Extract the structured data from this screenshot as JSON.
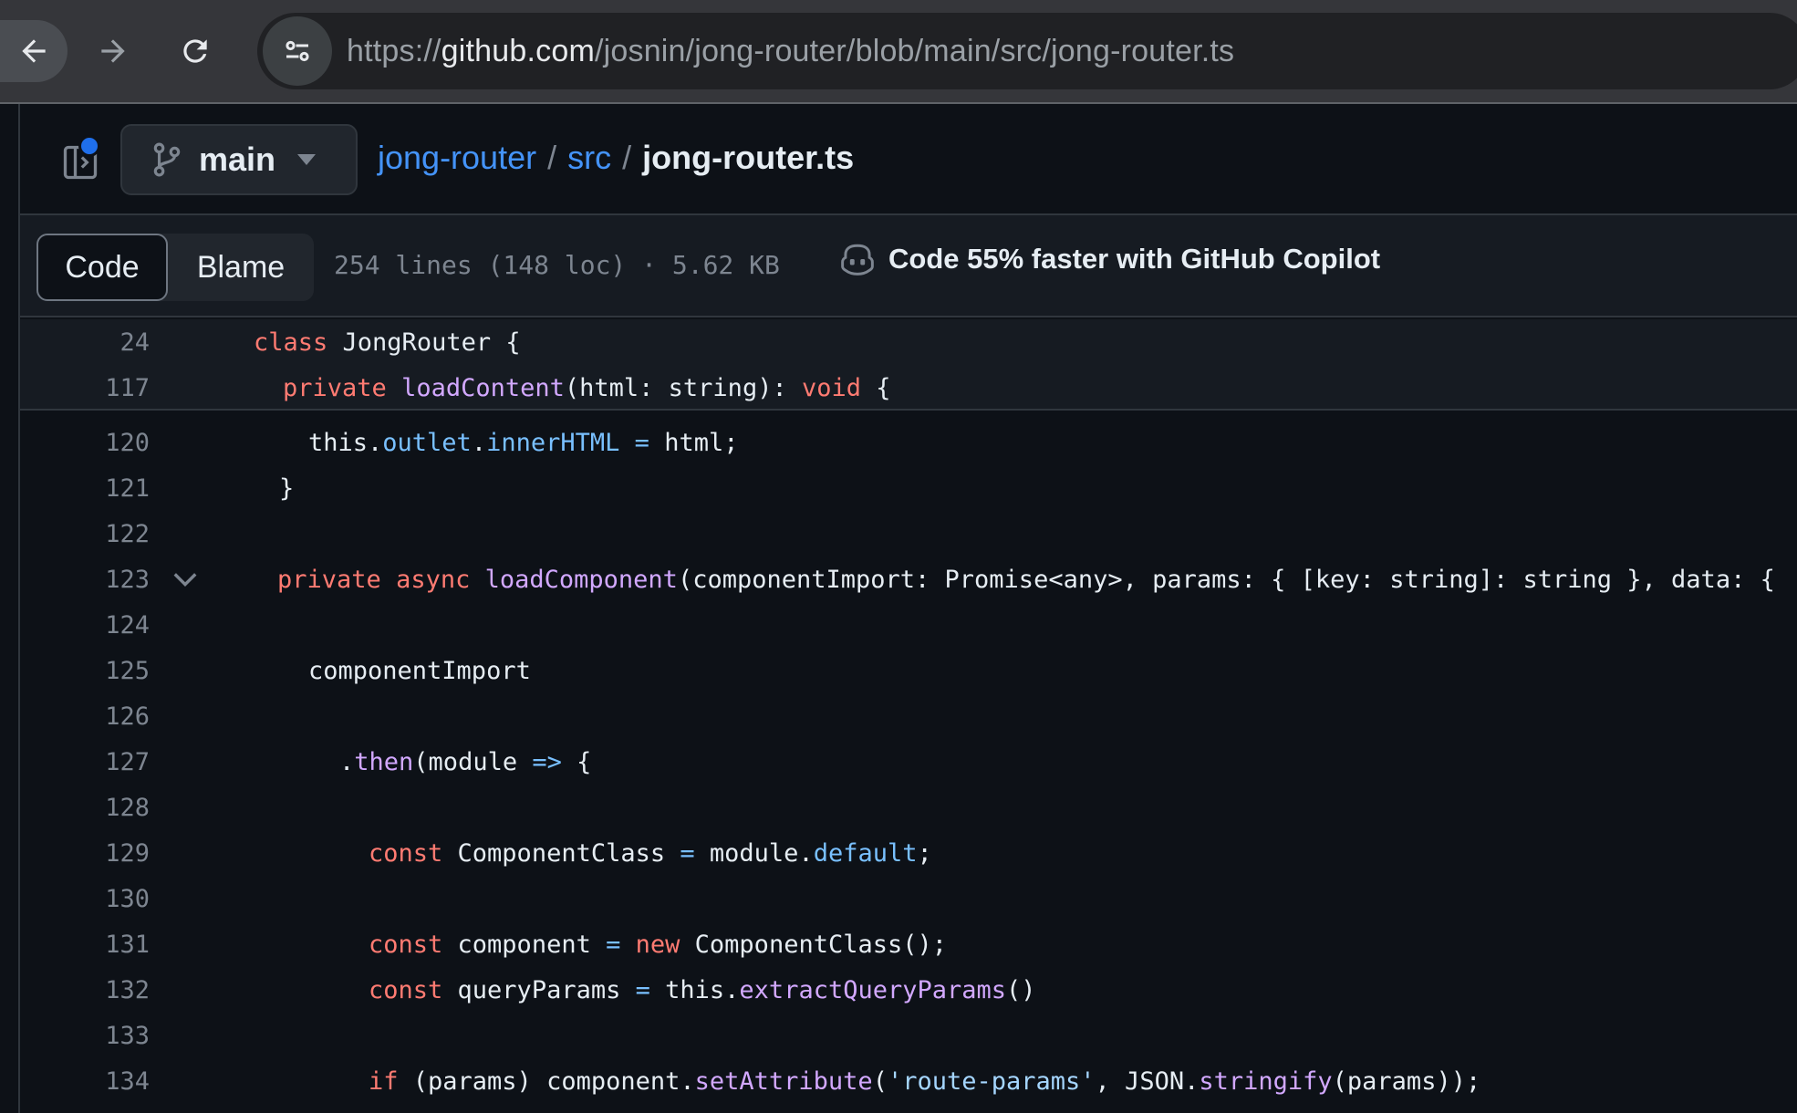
{
  "browser": {
    "url_scheme": "https://",
    "url_host": "github.com",
    "url_path": "/josnin/jong-router/blob/main/src/jong-router.ts",
    "icons": [
      "back-arrow-icon",
      "forward-arrow-icon",
      "reload-icon",
      "site-settings-icon"
    ]
  },
  "repo": {
    "branch": "main",
    "breadcrumb_repo": "jong-router",
    "breadcrumb_sep": "/",
    "breadcrumb_dir": "src",
    "breadcrumb_file": "jong-router.ts"
  },
  "toolbar": {
    "code_tab": "Code",
    "blame_tab": "Blame",
    "file_meta": "254 lines (148 loc) · 5.62 KB",
    "copilot_text": "Code 55% faster with GitHub Copilot"
  },
  "sticky_lines": [
    {
      "num": "24",
      "tokens": [
        [
          "k",
          "class"
        ],
        [
          "t",
          " JongRouter {"
        ]
      ]
    },
    {
      "num": "117",
      "tokens": [
        [
          "k",
          "private"
        ],
        [
          "t",
          " "
        ],
        [
          "f",
          "loadContent"
        ],
        [
          "t",
          "(html: string): "
        ],
        [
          "k",
          "void"
        ],
        [
          "t",
          " {"
        ]
      ]
    }
  ],
  "lines": [
    {
      "num": "120",
      "tokens": [
        [
          "t",
          "this."
        ],
        [
          "p",
          "outlet"
        ],
        [
          "t",
          "."
        ],
        [
          "p",
          "innerHTML"
        ],
        [
          "t",
          " "
        ],
        [
          "p",
          "="
        ],
        [
          "t",
          " html;"
        ]
      ]
    },
    {
      "num": "121",
      "tokens": [
        [
          "t",
          "}"
        ]
      ]
    },
    {
      "num": "122",
      "tokens": []
    },
    {
      "num": "123",
      "fold": true,
      "tokens": [
        [
          "k",
          "private"
        ],
        [
          "t",
          " "
        ],
        [
          "k",
          "async"
        ],
        [
          "t",
          " "
        ],
        [
          "f",
          "loadComponent"
        ],
        [
          "t",
          "(componentImport: Promise<any>, params: { [key: string]: string }, data: {"
        ]
      ]
    },
    {
      "num": "124",
      "tokens": []
    },
    {
      "num": "125",
      "tokens": [
        [
          "t",
          "componentImport"
        ]
      ]
    },
    {
      "num": "126",
      "tokens": []
    },
    {
      "num": "127",
      "tokens": [
        [
          "t",
          "."
        ],
        [
          "f",
          "then"
        ],
        [
          "t",
          "(module "
        ],
        [
          "p",
          "=>"
        ],
        [
          "t",
          " {"
        ]
      ]
    },
    {
      "num": "128",
      "tokens": []
    },
    {
      "num": "129",
      "tokens": [
        [
          "k",
          "const"
        ],
        [
          "t",
          " ComponentClass "
        ],
        [
          "p",
          "="
        ],
        [
          "t",
          " module."
        ],
        [
          "p",
          "default"
        ],
        [
          "t",
          ";"
        ]
      ]
    },
    {
      "num": "130",
      "tokens": []
    },
    {
      "num": "131",
      "tokens": [
        [
          "k",
          "const"
        ],
        [
          "t",
          " component "
        ],
        [
          "p",
          "="
        ],
        [
          "t",
          " "
        ],
        [
          "k",
          "new"
        ],
        [
          "t",
          " ComponentClass();"
        ]
      ]
    },
    {
      "num": "132",
      "tokens": [
        [
          "k",
          "const"
        ],
        [
          "t",
          " queryParams "
        ],
        [
          "p",
          "="
        ],
        [
          "t",
          " this."
        ],
        [
          "f",
          "extractQueryParams"
        ],
        [
          "t",
          "()"
        ]
      ]
    },
    {
      "num": "133",
      "tokens": []
    },
    {
      "num": "134",
      "tokens": [
        [
          "k",
          "if"
        ],
        [
          "t",
          " (params) component."
        ],
        [
          "f",
          "setAttribute"
        ],
        [
          "t",
          "("
        ],
        [
          "s",
          "'route-params'"
        ],
        [
          "t",
          ", JSON."
        ],
        [
          "f",
          "stringify"
        ],
        [
          "t",
          "(params));"
        ]
      ]
    }
  ]
}
